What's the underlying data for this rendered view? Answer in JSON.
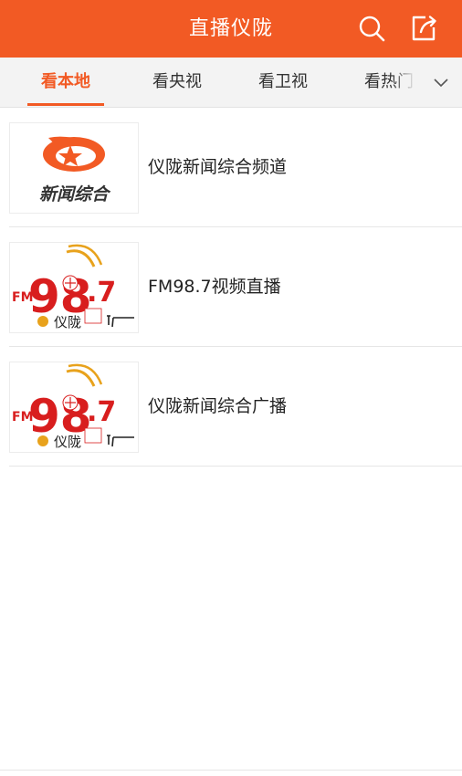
{
  "header": {
    "title": "直播仪陇",
    "search_icon": "search-icon",
    "share_icon": "share-icon"
  },
  "tabs": [
    {
      "label": "看本地",
      "active": true
    },
    {
      "label": "看央视",
      "active": false
    },
    {
      "label": "看卫视",
      "active": false
    },
    {
      "label": "看热门",
      "active": false
    }
  ],
  "tabs_more_icon": "chevron-down-icon",
  "channels": [
    {
      "name": "仪陇新闻综合频道",
      "logo_text": "新闻综合"
    },
    {
      "name": "FM98.7视频直播",
      "logo_text": "仪陇"
    },
    {
      "name": "仪陇新闻综合广播",
      "logo_text": "仪陇"
    }
  ],
  "colors": {
    "accent": "#f25a24",
    "tab_bar_bg": "#f3f3f3",
    "logo_red": "#d81e1e",
    "logo_gold": "#e8a21c"
  }
}
